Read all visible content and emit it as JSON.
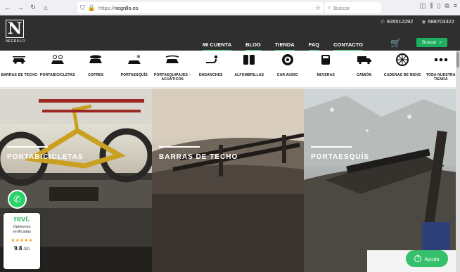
{
  "browser": {
    "url_prefix": "https://",
    "url_domain": "negrillo.es",
    "search_placeholder": "Buscar"
  },
  "header": {
    "logo_letter": "N",
    "logo_text": "NEGRILLO",
    "phone_1": "926512292",
    "phone_2": "688703322",
    "nav": [
      "MI CUENTA",
      "BLOG",
      "TIENDA",
      "FAQ",
      "CONTACTO"
    ],
    "search_button": "Buscar",
    "accent_color": "#36c06b"
  },
  "categories": [
    {
      "label": "BARRAS DE TECHO",
      "icon": "car-roof-bars-icon"
    },
    {
      "label": "PORTABICICLETAS",
      "icon": "bike-carrier-icon"
    },
    {
      "label": "COFRES",
      "icon": "roof-box-icon"
    },
    {
      "label": "PORTAESQUÍS",
      "icon": "ski-carrier-icon"
    },
    {
      "label": "PORTAEQUIPAJES – ACUÁTICOS",
      "icon": "kayak-carrier-icon"
    },
    {
      "label": "ENGANCHES",
      "icon": "tow-hitch-icon"
    },
    {
      "label": "ALFOMBRILLAS",
      "icon": "floor-mat-icon"
    },
    {
      "label": "CAR AUDIO",
      "icon": "speaker-icon"
    },
    {
      "label": "NEVERAS",
      "icon": "cooler-icon"
    },
    {
      "label": "CAMIÓN",
      "icon": "truck-icon"
    },
    {
      "label": "CADENAS DE NIEVE",
      "icon": "snow-chain-icon"
    },
    {
      "label": "TODA NUESTRA TIENDA",
      "icon": "more-dots-icon"
    }
  ],
  "hero": [
    {
      "title": "PORTABICICLETAS"
    },
    {
      "title": "BARRAS DE TECHO"
    },
    {
      "title": "PORTAESQUÍS"
    }
  ],
  "revi": {
    "brand": "revi.",
    "subtitle": "Opiniones verificadas",
    "stars": "★★★★★",
    "score": "9.8",
    "score_suffix": "/10"
  },
  "help_button": "Ayuda"
}
